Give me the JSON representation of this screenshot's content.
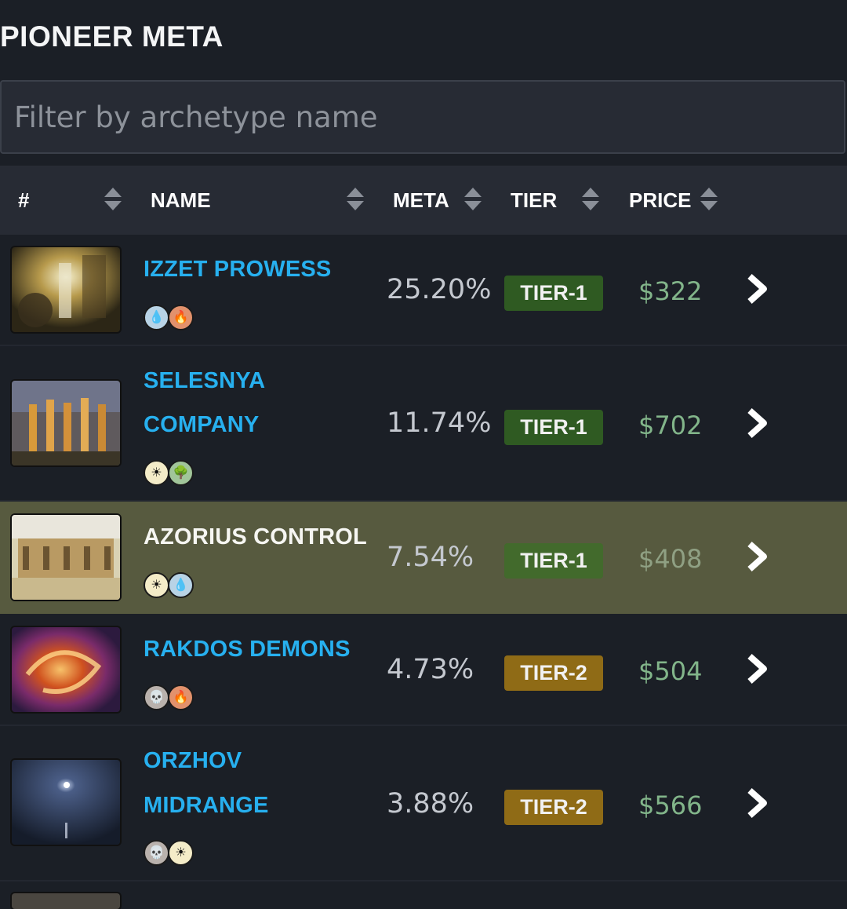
{
  "page": {
    "title": "PIONEER META"
  },
  "filter": {
    "placeholder": "Filter by archetype name",
    "value": ""
  },
  "table": {
    "headers": {
      "rank": "#",
      "name": "NAME",
      "meta": "META",
      "tier": "TIER",
      "price": "PRICE"
    },
    "rows": [
      {
        "name_lines": [
          "IZZET PROWESS"
        ],
        "mana": [
          {
            "color": "U",
            "icon": "water-drop-icon"
          },
          {
            "color": "R",
            "icon": "fire-icon"
          }
        ],
        "meta": "25.20%",
        "tier": "TIER-1",
        "price": "$322",
        "highlighted": false
      },
      {
        "name_lines": [
          "SELESNYA",
          "COMPANY"
        ],
        "mana": [
          {
            "color": "W",
            "icon": "sun-icon"
          },
          {
            "color": "G",
            "icon": "tree-icon"
          }
        ],
        "meta": "11.74%",
        "tier": "TIER-1",
        "price": "$702",
        "highlighted": false
      },
      {
        "name_lines": [
          "AZORIUS CONTROL"
        ],
        "mana": [
          {
            "color": "W",
            "icon": "sun-icon"
          },
          {
            "color": "U",
            "icon": "water-drop-icon"
          }
        ],
        "meta": "7.54%",
        "tier": "TIER-1",
        "price": "$408",
        "highlighted": true
      },
      {
        "name_lines": [
          "RAKDOS DEMONS"
        ],
        "mana": [
          {
            "color": "B",
            "icon": "skull-icon"
          },
          {
            "color": "R",
            "icon": "fire-icon"
          }
        ],
        "meta": "4.73%",
        "tier": "TIER-2",
        "price": "$504",
        "highlighted": false
      },
      {
        "name_lines": [
          "ORZHOV",
          "MIDRANGE"
        ],
        "mana": [
          {
            "color": "B",
            "icon": "skull-icon"
          },
          {
            "color": "W",
            "icon": "sun-icon"
          }
        ],
        "meta": "3.88%",
        "tier": "TIER-2",
        "price": "$566",
        "highlighted": false
      }
    ]
  },
  "colors": {
    "background": "#1b1f26",
    "header_bg": "#272b34",
    "deck_link": "#27b0ef",
    "highlight_row": "#575a3f",
    "tier1": "#2f5a22",
    "tier2": "#8f6b16",
    "price": "#82b58a"
  }
}
